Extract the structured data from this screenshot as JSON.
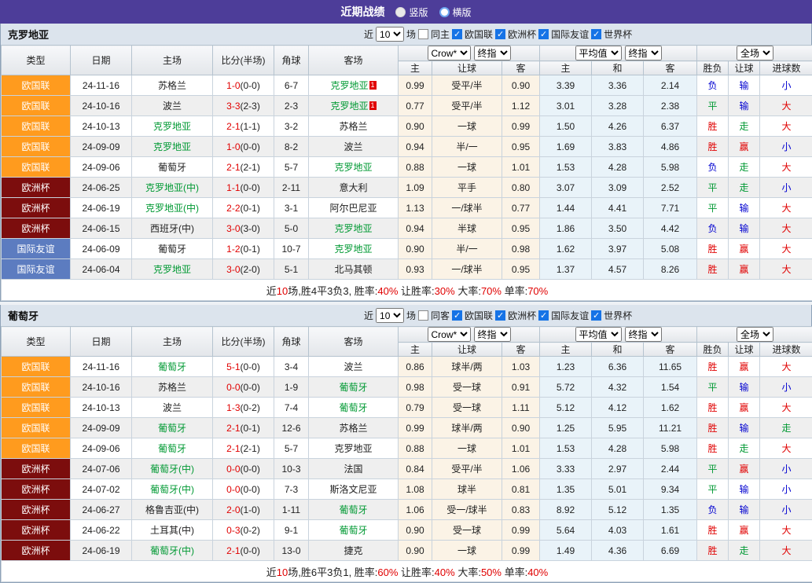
{
  "topbar": {
    "title": "近期战绩",
    "vertical_label": "竖版",
    "horizontal_label": "横版",
    "vertical_selected": true
  },
  "colors": {
    "accent_purple": "#4D3D99",
    "type_orange": "#FF9B1E",
    "type_maroon": "#7C0D0D",
    "type_blue": "#5C7CC0",
    "highlight_green": "#009933",
    "win_red": "#E00000",
    "draw_green": "#009933",
    "lose_blue": "#0000D0"
  },
  "columns": {
    "type": "类型",
    "date": "日期",
    "home": "主场",
    "score": "比分(半场)",
    "corner": "角球",
    "away": "客场",
    "odds_sub": [
      "主",
      "让球",
      "客"
    ],
    "avg_sub": [
      "主",
      "和",
      "客"
    ],
    "result_sub": [
      "胜负",
      "让球",
      "进球数"
    ]
  },
  "selects": {
    "odds_company": "Crow*",
    "odds_stage": "终指",
    "avg_name": "平均值",
    "avg_stage": "终指",
    "scope": "全场",
    "games_count": "10"
  },
  "filter": {
    "near": "近",
    "games": "场",
    "competitions": [
      "欧国联",
      "欧洲杯",
      "国际友谊",
      "世界杯"
    ]
  },
  "sections": [
    {
      "team": "克罗地亚",
      "same_filter": "同主",
      "rows": [
        {
          "type": "欧国联",
          "tc": "orange",
          "date": "24-11-16",
          "home": "苏格兰",
          "hh": false,
          "score": "1-0",
          "half": "(0-0)",
          "corner": "6-7",
          "away": "克罗地亚",
          "ah": true,
          "badge": "1",
          "odds": [
            "0.99",
            "受平/半",
            "0.90"
          ],
          "avg": [
            "3.39",
            "3.36",
            "2.14"
          ],
          "res": [
            [
              "负",
              "b"
            ],
            [
              "输",
              "b"
            ],
            [
              "小",
              "b"
            ]
          ]
        },
        {
          "type": "欧国联",
          "tc": "orange",
          "date": "24-10-16",
          "home": "波兰",
          "hh": false,
          "score": "3-3",
          "half": "(2-3)",
          "corner": "2-3",
          "away": "克罗地亚",
          "ah": true,
          "badge": "1",
          "odds": [
            "0.77",
            "受平/半",
            "1.12"
          ],
          "avg": [
            "3.01",
            "3.28",
            "2.38"
          ],
          "res": [
            [
              "平",
              "g"
            ],
            [
              "输",
              "b"
            ],
            [
              "大",
              "r"
            ]
          ]
        },
        {
          "type": "欧国联",
          "tc": "orange",
          "date": "24-10-13",
          "home": "克罗地亚",
          "hh": true,
          "score": "2-1",
          "half": "(1-1)",
          "corner": "3-2",
          "away": "苏格兰",
          "ah": false,
          "badge": "",
          "odds": [
            "0.90",
            "一球",
            "0.99"
          ],
          "avg": [
            "1.50",
            "4.26",
            "6.37"
          ],
          "res": [
            [
              "胜",
              "r"
            ],
            [
              "走",
              "g"
            ],
            [
              "大",
              "r"
            ]
          ]
        },
        {
          "type": "欧国联",
          "tc": "orange",
          "date": "24-09-09",
          "home": "克罗地亚",
          "hh": true,
          "score": "1-0",
          "half": "(0-0)",
          "corner": "8-2",
          "away": "波兰",
          "ah": false,
          "badge": "",
          "odds": [
            "0.94",
            "半/一",
            "0.95"
          ],
          "avg": [
            "1.69",
            "3.83",
            "4.86"
          ],
          "res": [
            [
              "胜",
              "r"
            ],
            [
              "赢",
              "r"
            ],
            [
              "小",
              "b"
            ]
          ]
        },
        {
          "type": "欧国联",
          "tc": "orange",
          "date": "24-09-06",
          "home": "葡萄牙",
          "hh": false,
          "score": "2-1",
          "half": "(2-1)",
          "corner": "5-7",
          "away": "克罗地亚",
          "ah": true,
          "badge": "",
          "odds": [
            "0.88",
            "一球",
            "1.01"
          ],
          "avg": [
            "1.53",
            "4.28",
            "5.98"
          ],
          "res": [
            [
              "负",
              "b"
            ],
            [
              "走",
              "g"
            ],
            [
              "大",
              "r"
            ]
          ]
        },
        {
          "type": "欧洲杯",
          "tc": "maroon",
          "date": "24-06-25",
          "home": "克罗地亚(中)",
          "hh": true,
          "score": "1-1",
          "half": "(0-0)",
          "corner": "2-11",
          "away": "意大利",
          "ah": false,
          "badge": "",
          "odds": [
            "1.09",
            "平手",
            "0.80"
          ],
          "avg": [
            "3.07",
            "3.09",
            "2.52"
          ],
          "res": [
            [
              "平",
              "g"
            ],
            [
              "走",
              "g"
            ],
            [
              "小",
              "b"
            ]
          ]
        },
        {
          "type": "欧洲杯",
          "tc": "maroon",
          "date": "24-06-19",
          "home": "克罗地亚(中)",
          "hh": true,
          "score": "2-2",
          "half": "(0-1)",
          "corner": "3-1",
          "away": "阿尔巴尼亚",
          "ah": false,
          "badge": "",
          "odds": [
            "1.13",
            "一/球半",
            "0.77"
          ],
          "avg": [
            "1.44",
            "4.41",
            "7.71"
          ],
          "res": [
            [
              "平",
              "g"
            ],
            [
              "输",
              "b"
            ],
            [
              "大",
              "r"
            ]
          ]
        },
        {
          "type": "欧洲杯",
          "tc": "maroon",
          "date": "24-06-15",
          "home": "西班牙(中)",
          "hh": false,
          "score": "3-0",
          "half": "(3-0)",
          "corner": "5-0",
          "away": "克罗地亚",
          "ah": true,
          "badge": "",
          "odds": [
            "0.94",
            "半球",
            "0.95"
          ],
          "avg": [
            "1.86",
            "3.50",
            "4.42"
          ],
          "res": [
            [
              "负",
              "b"
            ],
            [
              "输",
              "b"
            ],
            [
              "大",
              "r"
            ]
          ]
        },
        {
          "type": "国际友谊",
          "tc": "blue",
          "date": "24-06-09",
          "home": "葡萄牙",
          "hh": false,
          "score": "1-2",
          "half": "(0-1)",
          "corner": "10-7",
          "away": "克罗地亚",
          "ah": true,
          "badge": "",
          "odds": [
            "0.90",
            "半/一",
            "0.98"
          ],
          "avg": [
            "1.62",
            "3.97",
            "5.08"
          ],
          "res": [
            [
              "胜",
              "r"
            ],
            [
              "赢",
              "r"
            ],
            [
              "大",
              "r"
            ]
          ]
        },
        {
          "type": "国际友谊",
          "tc": "blue",
          "date": "24-06-04",
          "home": "克罗地亚",
          "hh": true,
          "score": "3-0",
          "half": "(2-0)",
          "corner": "5-1",
          "away": "北马其顿",
          "ah": false,
          "badge": "",
          "odds": [
            "0.93",
            "一/球半",
            "0.95"
          ],
          "avg": [
            "1.37",
            "4.57",
            "8.26"
          ],
          "res": [
            [
              "胜",
              "r"
            ],
            [
              "赢",
              "r"
            ],
            [
              "大",
              "r"
            ]
          ]
        }
      ],
      "summary": [
        [
          "近",
          "k"
        ],
        [
          "10",
          "r"
        ],
        [
          "场,胜4平3负3, 胜率:",
          "k"
        ],
        [
          "40%",
          "r"
        ],
        [
          " 让胜率:",
          "k"
        ],
        [
          "30%",
          "r"
        ],
        [
          " 大率:",
          "k"
        ],
        [
          "70%",
          "r"
        ],
        [
          " 单率:",
          "k"
        ],
        [
          "70%",
          "r"
        ]
      ]
    },
    {
      "team": "葡萄牙",
      "same_filter": "同客",
      "rows": [
        {
          "type": "欧国联",
          "tc": "orange",
          "date": "24-11-16",
          "home": "葡萄牙",
          "hh": true,
          "score": "5-1",
          "half": "(0-0)",
          "corner": "3-4",
          "away": "波兰",
          "ah": false,
          "badge": "",
          "odds": [
            "0.86",
            "球半/两",
            "1.03"
          ],
          "avg": [
            "1.23",
            "6.36",
            "11.65"
          ],
          "res": [
            [
              "胜",
              "r"
            ],
            [
              "赢",
              "r"
            ],
            [
              "大",
              "r"
            ]
          ]
        },
        {
          "type": "欧国联",
          "tc": "orange",
          "date": "24-10-16",
          "home": "苏格兰",
          "hh": false,
          "score": "0-0",
          "half": "(0-0)",
          "corner": "1-9",
          "away": "葡萄牙",
          "ah": true,
          "badge": "",
          "odds": [
            "0.98",
            "受一球",
            "0.91"
          ],
          "avg": [
            "5.72",
            "4.32",
            "1.54"
          ],
          "res": [
            [
              "平",
              "g"
            ],
            [
              "输",
              "b"
            ],
            [
              "小",
              "b"
            ]
          ]
        },
        {
          "type": "欧国联",
          "tc": "orange",
          "date": "24-10-13",
          "home": "波兰",
          "hh": false,
          "score": "1-3",
          "half": "(0-2)",
          "corner": "7-4",
          "away": "葡萄牙",
          "ah": true,
          "badge": "",
          "odds": [
            "0.79",
            "受一球",
            "1.11"
          ],
          "avg": [
            "5.12",
            "4.12",
            "1.62"
          ],
          "res": [
            [
              "胜",
              "r"
            ],
            [
              "赢",
              "r"
            ],
            [
              "大",
              "r"
            ]
          ]
        },
        {
          "type": "欧国联",
          "tc": "orange",
          "date": "24-09-09",
          "home": "葡萄牙",
          "hh": true,
          "score": "2-1",
          "half": "(0-1)",
          "corner": "12-6",
          "away": "苏格兰",
          "ah": false,
          "badge": "",
          "odds": [
            "0.99",
            "球半/两",
            "0.90"
          ],
          "avg": [
            "1.25",
            "5.95",
            "11.21"
          ],
          "res": [
            [
              "胜",
              "r"
            ],
            [
              "输",
              "b"
            ],
            [
              "走",
              "g"
            ]
          ]
        },
        {
          "type": "欧国联",
          "tc": "orange",
          "date": "24-09-06",
          "home": "葡萄牙",
          "hh": true,
          "score": "2-1",
          "half": "(2-1)",
          "corner": "5-7",
          "away": "克罗地亚",
          "ah": false,
          "badge": "",
          "odds": [
            "0.88",
            "一球",
            "1.01"
          ],
          "avg": [
            "1.53",
            "4.28",
            "5.98"
          ],
          "res": [
            [
              "胜",
              "r"
            ],
            [
              "走",
              "g"
            ],
            [
              "大",
              "r"
            ]
          ]
        },
        {
          "type": "欧洲杯",
          "tc": "maroon",
          "date": "24-07-06",
          "home": "葡萄牙(中)",
          "hh": true,
          "score": "0-0",
          "half": "(0-0)",
          "corner": "10-3",
          "away": "法国",
          "ah": false,
          "badge": "",
          "odds": [
            "0.84",
            "受平/半",
            "1.06"
          ],
          "avg": [
            "3.33",
            "2.97",
            "2.44"
          ],
          "res": [
            [
              "平",
              "g"
            ],
            [
              "赢",
              "r"
            ],
            [
              "小",
              "b"
            ]
          ]
        },
        {
          "type": "欧洲杯",
          "tc": "maroon",
          "date": "24-07-02",
          "home": "葡萄牙(中)",
          "hh": true,
          "score": "0-0",
          "half": "(0-0)",
          "corner": "7-3",
          "away": "斯洛文尼亚",
          "ah": false,
          "badge": "",
          "odds": [
            "1.08",
            "球半",
            "0.81"
          ],
          "avg": [
            "1.35",
            "5.01",
            "9.34"
          ],
          "res": [
            [
              "平",
              "g"
            ],
            [
              "输",
              "b"
            ],
            [
              "小",
              "b"
            ]
          ]
        },
        {
          "type": "欧洲杯",
          "tc": "maroon",
          "date": "24-06-27",
          "home": "格鲁吉亚(中)",
          "hh": false,
          "score": "2-0",
          "half": "(1-0)",
          "corner": "1-11",
          "away": "葡萄牙",
          "ah": true,
          "badge": "",
          "odds": [
            "1.06",
            "受一/球半",
            "0.83"
          ],
          "avg": [
            "8.92",
            "5.12",
            "1.35"
          ],
          "res": [
            [
              "负",
              "b"
            ],
            [
              "输",
              "b"
            ],
            [
              "小",
              "b"
            ]
          ]
        },
        {
          "type": "欧洲杯",
          "tc": "maroon",
          "date": "24-06-22",
          "home": "土耳其(中)",
          "hh": false,
          "score": "0-3",
          "half": "(0-2)",
          "corner": "9-1",
          "away": "葡萄牙",
          "ah": true,
          "badge": "",
          "odds": [
            "0.90",
            "受一球",
            "0.99"
          ],
          "avg": [
            "5.64",
            "4.03",
            "1.61"
          ],
          "res": [
            [
              "胜",
              "r"
            ],
            [
              "赢",
              "r"
            ],
            [
              "大",
              "r"
            ]
          ]
        },
        {
          "type": "欧洲杯",
          "tc": "maroon",
          "date": "24-06-19",
          "home": "葡萄牙(中)",
          "hh": true,
          "score": "2-1",
          "half": "(0-0)",
          "corner": "13-0",
          "away": "捷克",
          "ah": false,
          "badge": "",
          "odds": [
            "0.90",
            "一球",
            "0.99"
          ],
          "avg": [
            "1.49",
            "4.36",
            "6.69"
          ],
          "res": [
            [
              "胜",
              "r"
            ],
            [
              "走",
              "g"
            ],
            [
              "大",
              "r"
            ]
          ]
        }
      ],
      "summary": [
        [
          "近",
          "k"
        ],
        [
          "10",
          "r"
        ],
        [
          "场,胜6平3负1, 胜率:",
          "k"
        ],
        [
          "60%",
          "r"
        ],
        [
          " 让胜率:",
          "k"
        ],
        [
          "40%",
          "r"
        ],
        [
          " 大率:",
          "k"
        ],
        [
          "50%",
          "r"
        ],
        [
          " 单率:",
          "k"
        ],
        [
          "40%",
          "r"
        ]
      ]
    }
  ]
}
